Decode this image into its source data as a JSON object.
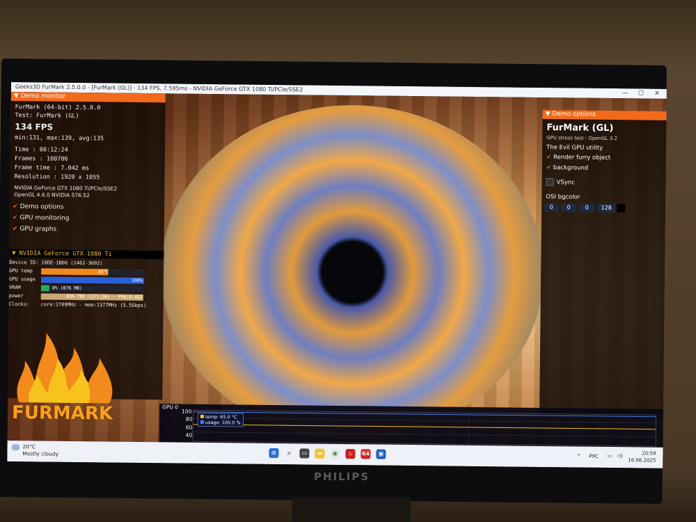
{
  "window": {
    "title": "Geeks3D FurMark 2.5.0.0 - [FurMark (GL)] - 134 FPS, 7.595ms - NVIDIA GeForce GTX 1080 Ti/PCIe/SSE2",
    "minimize": "—",
    "maximize": "☐",
    "close": "✕"
  },
  "monitor": {
    "header": "Demo monitor",
    "app": "FurMark (64-bit) 2.5.0.0",
    "test": "Test: FurMark (GL)",
    "fps": "134 FPS",
    "minmax": "min:131, max:139, avg:135",
    "time": "Time       : 00:12:24",
    "frames": "Frames     : 100706",
    "frametime": "Frame time : 7.042 ms",
    "resolution": "Resolution : 1920 x 1055",
    "gpu": "NVIDIA GeForce GTX 1080 Ti/PCIe/SSE2",
    "opengl": "OpenGL 4.6.0 NVIDIA 576.52",
    "checkboxes": [
      "Demo options",
      "GPU monitoring",
      "GPU graphs"
    ]
  },
  "gpu_panel": {
    "header": "NVIDIA GeForce GTX 1080 Ti",
    "device_label": "Device ID:",
    "device_value": "10DE-1B06 (1462-3602)",
    "temp_label": "GPU temp",
    "temp_value": "65°C",
    "temp_fill": 0.65,
    "usage_label": "GPU usage",
    "usage_value": "100%",
    "usage_fill": 1.0,
    "vram_label": "VRAM",
    "vram_value": "8% (876 MB)",
    "vram_fill": 0.08,
    "power_label": "power",
    "power_value": "99% TDP (277.2W) - PPW:0.483",
    "power_fill": 0.99,
    "clocks_label": "Clocks:",
    "clocks_value": "core:1709MHz - mem:1377MHz (5.5Gbps)"
  },
  "logo": {
    "text": "FURMARK"
  },
  "options": {
    "header": "Demo options",
    "title": "FurMark (GL)",
    "subtitle": "GPU stress test - OpenGL 3.2",
    "tagline": "The Evil GPU utility",
    "render_furry": "Render furry object",
    "background": "background",
    "vsync": "VSync",
    "osi_label": "OSI bgcolor",
    "osi_values": [
      "0",
      "0",
      "0",
      "128"
    ]
  },
  "graph": {
    "label": "GPU 0",
    "ticks": [
      "100",
      "80",
      "60",
      "40"
    ],
    "legend_temp": "temp: 65.0 °C",
    "legend_usage": "usage: 100.0 %",
    "temp_color": "#f7c21c",
    "usage_color": "#4a7ef0"
  },
  "taskbar": {
    "temp": "20°C",
    "weather": "Mostly cloudy",
    "lang": "РУС",
    "time": "20:59",
    "date": "16.06.2025",
    "badge": "64"
  },
  "monitor_brand": "PHILIPS"
}
